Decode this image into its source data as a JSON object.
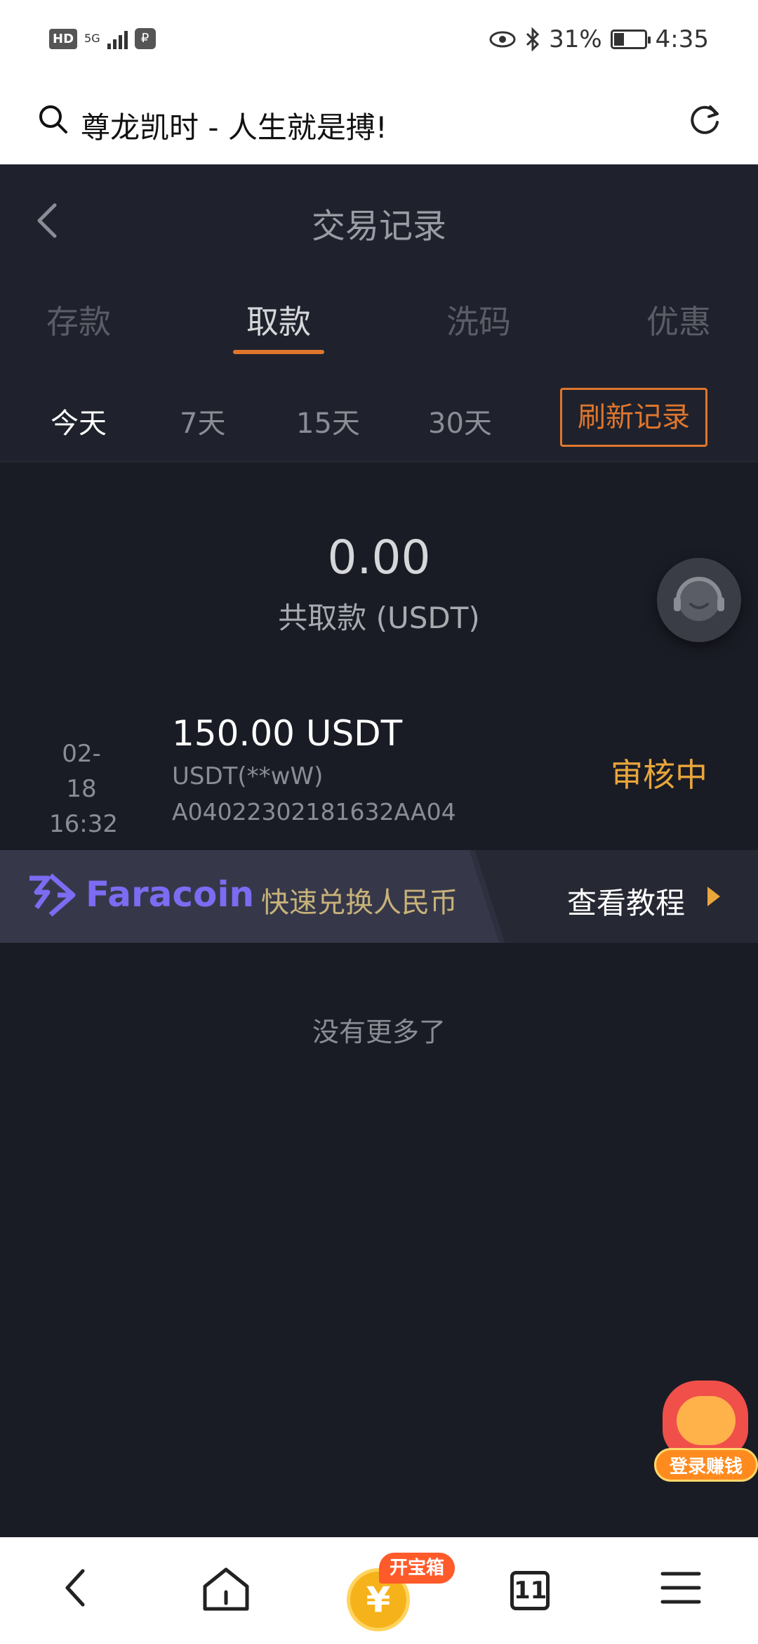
{
  "status_bar": {
    "left_icons": [
      "hd-icon",
      "5g-signal-icon",
      "payment-icon"
    ],
    "hd": "HD",
    "network": "5G",
    "battery_percent": "31%",
    "time": "4:35"
  },
  "browser": {
    "address_text": "尊龙凯时 - 人生就是搏!"
  },
  "header": {
    "title": "交易记录"
  },
  "tabs": [
    {
      "label": "存款",
      "active": false
    },
    {
      "label": "取款",
      "active": true
    },
    {
      "label": "洗码",
      "active": false
    },
    {
      "label": "优惠",
      "active": false
    }
  ],
  "filters": {
    "options": [
      "今天",
      "7天",
      "15天",
      "30天"
    ],
    "selected": "今天",
    "refresh_label": "刷新记录"
  },
  "summary": {
    "amount": "0.00",
    "label": "共取款 (USDT)"
  },
  "records": [
    {
      "date": "02-18",
      "time": "16:32",
      "amount": "150.00 USDT",
      "currency": "USDT(**wW)",
      "order_id": "A04022302181632AA04",
      "status": "审核中"
    }
  ],
  "banner": {
    "brand": "Faracoin",
    "slogan": "快速兑换人民币",
    "cta": "查看教程"
  },
  "footer_text": "没有更多了",
  "promo": {
    "label": "登录赚钱"
  },
  "bottom_nav": {
    "coin_symbol": "¥",
    "coin_badge": "开宝箱",
    "tab_count": "11"
  },
  "colors": {
    "accent": "#e0762d",
    "status_pending": "#e8a63b",
    "background": "#1a1c25",
    "brand_purple": "#7b6cf2"
  }
}
